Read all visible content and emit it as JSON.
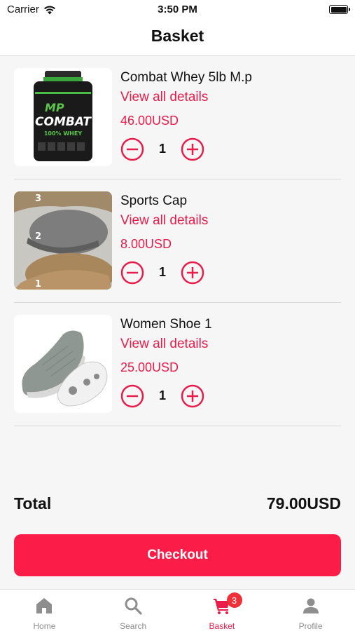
{
  "status_bar": {
    "carrier": "Carrier",
    "time": "3:50 PM"
  },
  "header": {
    "title": "Basket"
  },
  "items": [
    {
      "name": "Combat Whey 5lb M.p",
      "link": "View all details",
      "price": "46.00USD",
      "quantity": "1",
      "image_text": "COMBAT",
      "image_subtext": "100% WHEY"
    },
    {
      "name": "Sports Cap",
      "link": "View all details",
      "price": "8.00USD",
      "quantity": "1",
      "image_numbers": [
        "3",
        "2",
        "1"
      ]
    },
    {
      "name": "Women Shoe 1",
      "link": "View all details",
      "price": "25.00USD",
      "quantity": "1"
    }
  ],
  "summary": {
    "total_label": "Total",
    "total_value": "79.00USD"
  },
  "checkout": {
    "label": "Checkout"
  },
  "tabs": [
    {
      "label": "Home",
      "icon": "home-icon"
    },
    {
      "label": "Search",
      "icon": "search-icon"
    },
    {
      "label": "Basket",
      "icon": "cart-icon",
      "badge": "3",
      "active": true
    },
    {
      "label": "Profile",
      "icon": "person-icon"
    }
  ],
  "colors": {
    "accent": "#ea1c4a",
    "button": "#fb1c47",
    "badge": "#ef2f3a",
    "inactive_tab": "#8e8e8e"
  }
}
